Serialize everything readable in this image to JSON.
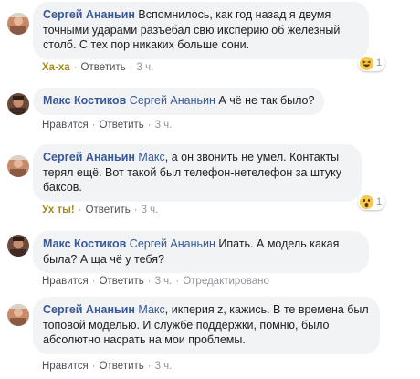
{
  "comments": [
    {
      "author": "Сергей Ананьин",
      "mention": "",
      "text": "Вспомнилось, как год назад я двумя точными ударами разъебал свю иксперию об железный столб. С тех пор никаких больше сони.",
      "reaction_label": "Ха-ха",
      "reply_label": "Ответить",
      "time": "3 ч.",
      "badge_count": "1",
      "badge_emoji": "laugh-emoji-icon"
    },
    {
      "author": "Макс Костиков",
      "mention": "Сергей Ананьин",
      "text": "А чё не так было?",
      "reaction_label": "Нравится",
      "reply_label": "Ответить",
      "time": "3 ч."
    },
    {
      "author": "Сергей Ананьин",
      "mention": "Макс",
      "text": ", а он звонить не умел. Контакты терял ещё. Вот такой был телефон-нетелефон за штуку баксов.",
      "reaction_label": "Ух ты!",
      "reply_label": "Ответить",
      "time": "3 ч.",
      "badge_count": "1",
      "badge_emoji": "wow-emoji-icon"
    },
    {
      "author": "Макс Костиков",
      "mention": "Сергей Ананьин",
      "text": "Ипать. А модель какая была? А ща чё у тебя?",
      "reaction_label": "Нравится",
      "reply_label": "Ответить",
      "time": "3 ч.",
      "edited_label": "Отредактировано"
    },
    {
      "author": "Сергей Ананьин",
      "mention": "Макс",
      "text": ", икперия z, кажись. В те времена был топовой моделью. И службе поддержки, помню, было абсолютно насрать на мои проблемы.",
      "reaction_label": "Нравится",
      "reply_label": "Ответить",
      "time": "3 ч."
    }
  ],
  "colors": {
    "author": "#385898",
    "bubble": "#f2f3f5",
    "meta": "#90949c",
    "reaction_gold": "#a8881a"
  }
}
